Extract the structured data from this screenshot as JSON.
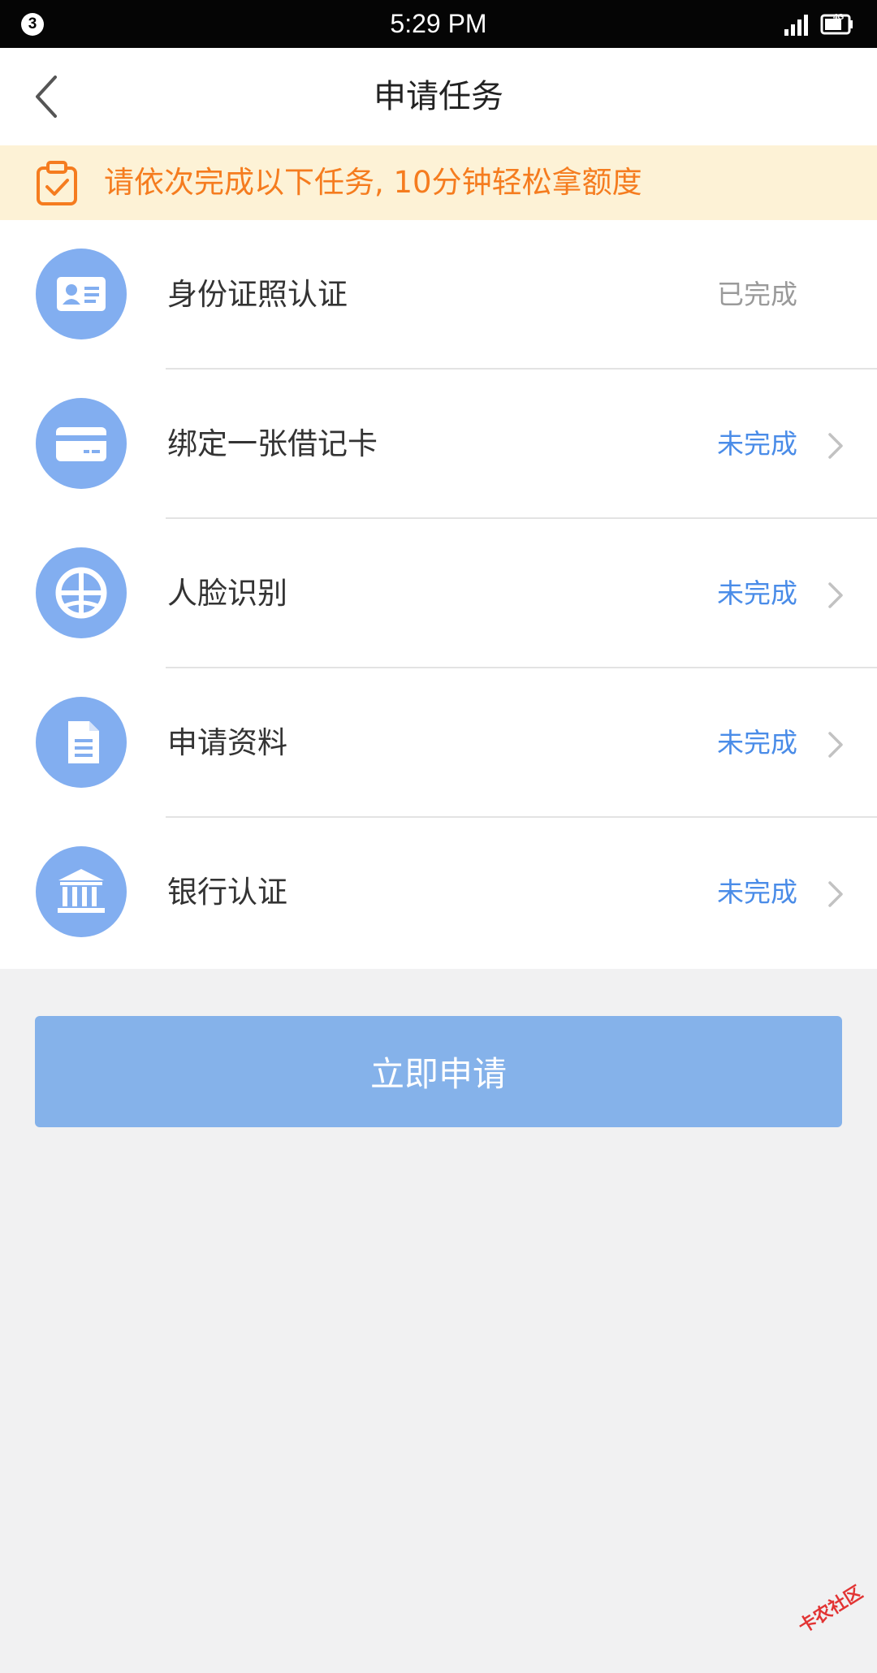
{
  "status_bar": {
    "notification_count": "3",
    "time": "5:29 PM",
    "network": "4G"
  },
  "header": {
    "title": "申请任务",
    "back_icon": "chevron-left-icon"
  },
  "banner": {
    "icon": "clipboard-check-icon",
    "text": "请依次完成以下任务, 10分钟轻松拿额度",
    "color": "#f57c1f",
    "background": "#fdf2d6"
  },
  "tasks": [
    {
      "icon": "id-card-icon",
      "label": "身份证照认证",
      "status": "已完成",
      "completed": true
    },
    {
      "icon": "bank-card-icon",
      "label": "绑定一张借记卡",
      "status": "未完成",
      "completed": false
    },
    {
      "icon": "face-recognition-icon",
      "label": "人脸识别",
      "status": "未完成",
      "completed": false
    },
    {
      "icon": "document-icon",
      "label": "申请资料",
      "status": "未完成",
      "completed": false
    },
    {
      "icon": "bank-building-icon",
      "label": "银行认证",
      "status": "未完成",
      "completed": false
    }
  ],
  "apply_button": {
    "label": "立即申请",
    "color": "#85b2ea"
  },
  "watermark": {
    "text": "卡农社区"
  },
  "colors": {
    "accent_blue": "#4a8ce8",
    "icon_blue": "#82aef0",
    "done_gray": "#9a9a9a"
  }
}
